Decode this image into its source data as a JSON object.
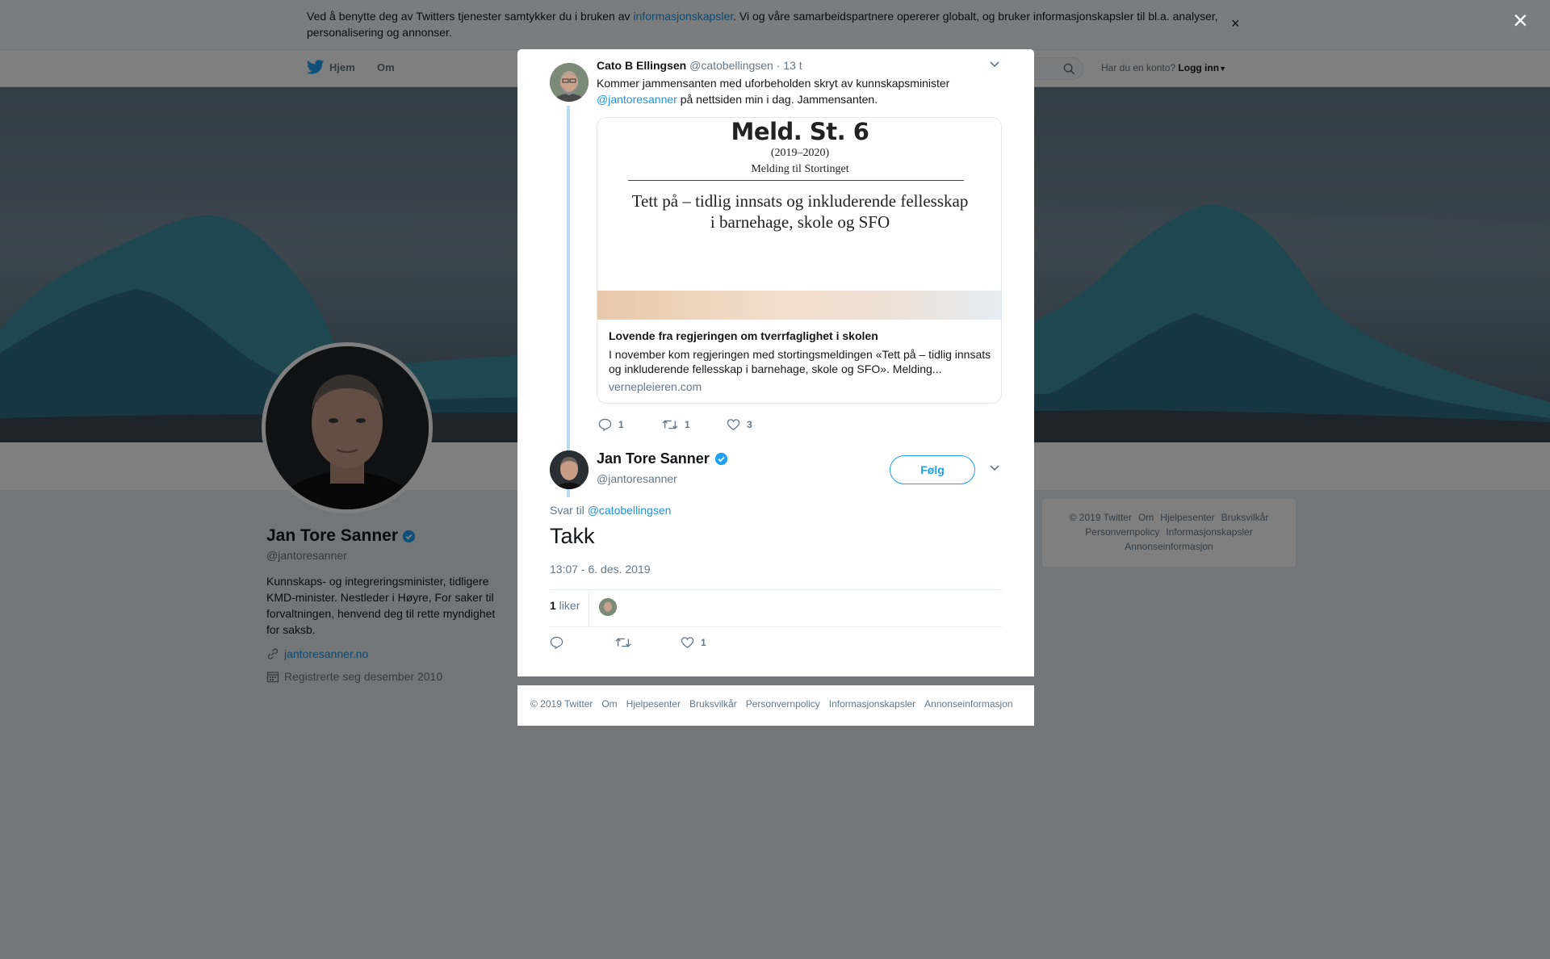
{
  "cookie_banner": {
    "text_before": "Ved å benytte deg av Twitters tjenester samtykker du i bruken av ",
    "link": "informasjonskapsler",
    "text_after": ". Vi og våre samarbeidspartnere opererer globalt, og bruker informasjonskapsler til bl.a. analyser, personalisering og annonser.",
    "close": "×"
  },
  "nav": {
    "home": "Hjem",
    "about": "Om",
    "account_prompt": "Har du en konto?",
    "login": "Logg inn"
  },
  "profile": {
    "name": "Jan Tore Sanner",
    "handle": "@jantoresanner",
    "bio": "Kunnskaps- og integreringsminister, tidligere KMD-minister. Nestleder i Høyre, For saker til forvaltningen, henvend deg til rette myndighet for saksb.",
    "website": "jantoresanner.no",
    "joined": "Registrerte seg desember 2010"
  },
  "sidebar_footer": [
    "© 2019 Twitter",
    "Om",
    "Hjelpesenter",
    "Bruksvilkår",
    "Personvernpolicy",
    "Informasjonskapsler",
    "Annonseinformasjon"
  ],
  "overlay_close": "×",
  "parent_tweet": {
    "name": "Cato B Ellingsen",
    "handle": "@catobellingsen",
    "time": "· 13 t",
    "text_before": "Kommer jammensanten med uforbeholden skryt av kunnskapsminister ",
    "mention": "@jantoresanner",
    "text_after": " på nettsiden min i dag. Jammensanten.",
    "card": {
      "image_title": "Meld. St. 6",
      "image_years": "(2019–2020)",
      "image_subtitle": "Melding til Stortinget",
      "image_main": "Tett på – tidlig innsats og inkluderende fellesskap i barnehage, skole og SFO",
      "title": "Lovende fra regjeringen om tverrfaglighet i skolen",
      "description": "I november kom regjeringen med stortingsmeldingen «Tett på – tidlig innsats og inkluderende fellesskap i barnehage, skole og SFO». Melding...",
      "domain": "vernepleieren.com"
    },
    "replies": "1",
    "retweets": "1",
    "likes": "3"
  },
  "main_tweet": {
    "name": "Jan Tore Sanner",
    "handle": "@jantoresanner",
    "follow_label": "Følg",
    "reply_to_prefix": "Svar til ",
    "reply_to_handle": "@catobellingsen",
    "text": "Takk",
    "timestamp": "13:07 - 6. des. 2019",
    "like_count": "1",
    "like_word": " liker",
    "action_like_count": "1"
  },
  "modal_footer": [
    "© 2019 Twitter",
    "Om",
    "Hjelpesenter",
    "Bruksvilkår",
    "Personvernpolicy",
    "Informasjonskapsler",
    "Annonseinformasjon"
  ],
  "colors": {
    "accent": "#1da1f2",
    "link": "#1b95e0",
    "verified": "#1da1f2",
    "muted": "#657786",
    "thread_line": "#b8dcf4"
  },
  "icons": [
    "twitter-bird-icon",
    "search-icon",
    "caret-down-icon",
    "verified-badge-icon",
    "link-icon",
    "calendar-icon",
    "close-icon",
    "chevron-down-icon",
    "reply-icon",
    "retweet-icon",
    "heart-icon"
  ]
}
